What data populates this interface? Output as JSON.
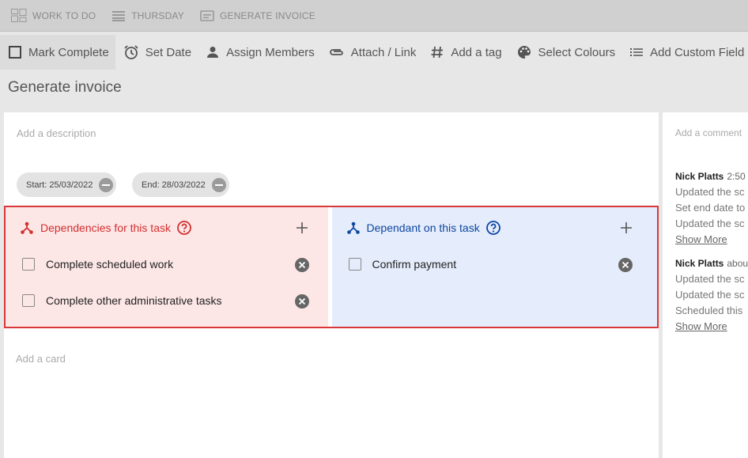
{
  "breadcrumbs": [
    {
      "label": "WORK TO DO",
      "icon": "board-icon"
    },
    {
      "label": "THURSDAY",
      "icon": "list-lines-icon"
    },
    {
      "label": "GENERATE INVOICE",
      "icon": "card-icon"
    }
  ],
  "toolbar": {
    "mark_complete": "Mark Complete",
    "set_date": "Set Date",
    "assign_members": "Assign Members",
    "attach_link": "Attach / Link",
    "add_tag": "Add a tag",
    "select_colours": "Select Colours",
    "add_custom_field": "Add Custom Field"
  },
  "card": {
    "title": "Generate invoice",
    "description_placeholder": "Add a description",
    "start_date": "Start: 25/03/2022",
    "end_date": "End: 28/03/2022",
    "add_card": "Add a card"
  },
  "dependencies": {
    "label": "Dependencies for this task",
    "color": "#d32f2f",
    "items": [
      "Complete scheduled work",
      "Complete other administrative tasks"
    ]
  },
  "dependants": {
    "label": "Dependant on this task",
    "color": "#0d47a1",
    "items": [
      "Confirm payment"
    ]
  },
  "comments": {
    "placeholder": "Add a comment",
    "activity": [
      {
        "author": "Nick Platts",
        "time": "2:50",
        "lines": [
          "Updated the sc",
          "Set end date to",
          "Updated the sc"
        ],
        "show_more": "Show More"
      },
      {
        "author": "Nick Platts",
        "time": "abou",
        "lines": [
          "Updated the sc",
          "Updated the sc",
          "Scheduled this"
        ],
        "show_more": "Show More"
      }
    ]
  }
}
